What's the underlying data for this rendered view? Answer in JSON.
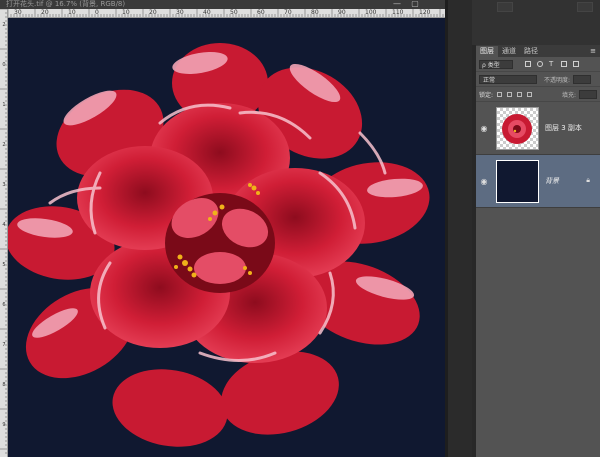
{
  "document": {
    "tab_title": "打开花头.tif @ 16.7% (背景, RGB/8)",
    "window_buttons": [
      "—",
      "▢"
    ]
  },
  "ruler": {
    "top_labels": [
      "30",
      "20",
      "10",
      "0",
      "10",
      "20",
      "30",
      "40",
      "50",
      "60",
      "70",
      "80",
      "90",
      "100",
      "110",
      "120"
    ],
    "left_labels": [
      "2",
      "0",
      "1",
      "2",
      "3",
      "4",
      "5",
      "6",
      "7",
      "8",
      "9"
    ]
  },
  "layers_panel": {
    "tabs": [
      "图层",
      "通道",
      "路径"
    ],
    "active_tab": "图层",
    "menu_icon": "panel-menu-icon",
    "filter": {
      "kind_label": "ρ 类型",
      "icons": [
        "image-filter-icon",
        "adjustment-filter-icon",
        "type-filter-icon",
        "shape-filter-icon",
        "smart-filter-icon"
      ]
    },
    "blend_mode": "正常",
    "opacity_label": "不透明度:",
    "lock_label": "锁定:",
    "fill_label": "填充:",
    "layers": [
      {
        "name": "图层 3 副本",
        "visible_icon": "eye-icon",
        "selected": false,
        "locked": false
      },
      {
        "name": "背景",
        "visible_icon": "eye-icon",
        "selected": true,
        "locked": true
      }
    ]
  },
  "colors": {
    "canvas_background": "#101830",
    "panel_background": "#535353",
    "selected_layer": "#5d6c82"
  }
}
